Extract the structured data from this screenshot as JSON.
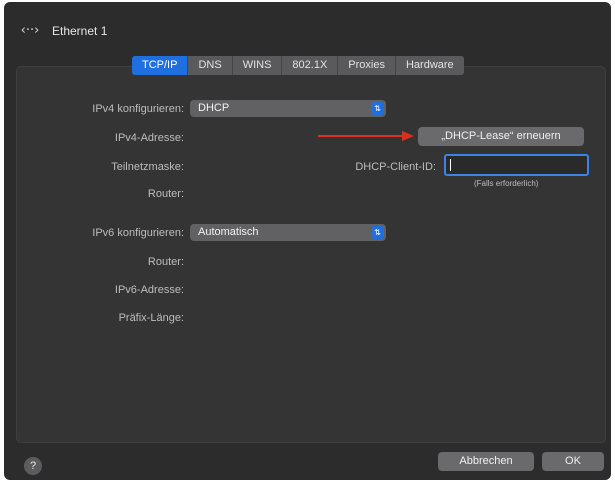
{
  "window": {
    "title": "Ethernet 1",
    "title_icon": "network-arrows-icon"
  },
  "tabs": [
    {
      "label": "TCP/IP",
      "active": true
    },
    {
      "label": "DNS",
      "active": false
    },
    {
      "label": "WINS",
      "active": false
    },
    {
      "label": "802.1X",
      "active": false
    },
    {
      "label": "Proxies",
      "active": false
    },
    {
      "label": "Hardware",
      "active": false
    }
  ],
  "ipv4": {
    "configure_label": "IPv4 konfigurieren:",
    "configure_value": "DHCP",
    "address_label": "IPv4-Adresse:",
    "subnet_label": "Teilnetzmaske:",
    "router_label": "Router:",
    "renew_button": "„DHCP-Lease“ erneuern",
    "client_id_label": "DHCP-Client-ID:",
    "client_id_value": "",
    "client_id_hint": "(Falls erforderlich)"
  },
  "ipv6": {
    "configure_label": "IPv6 konfigurieren:",
    "configure_value": "Automatisch",
    "router_label": "Router:",
    "address_label": "IPv6-Adresse:",
    "prefix_label": "Präfix-Länge:"
  },
  "footer": {
    "help_label": "?",
    "cancel_button": "Abbrechen",
    "ok_button": "OK"
  },
  "colors": {
    "accent": "#1f6fe0",
    "annotation_arrow": "#d9301f"
  }
}
